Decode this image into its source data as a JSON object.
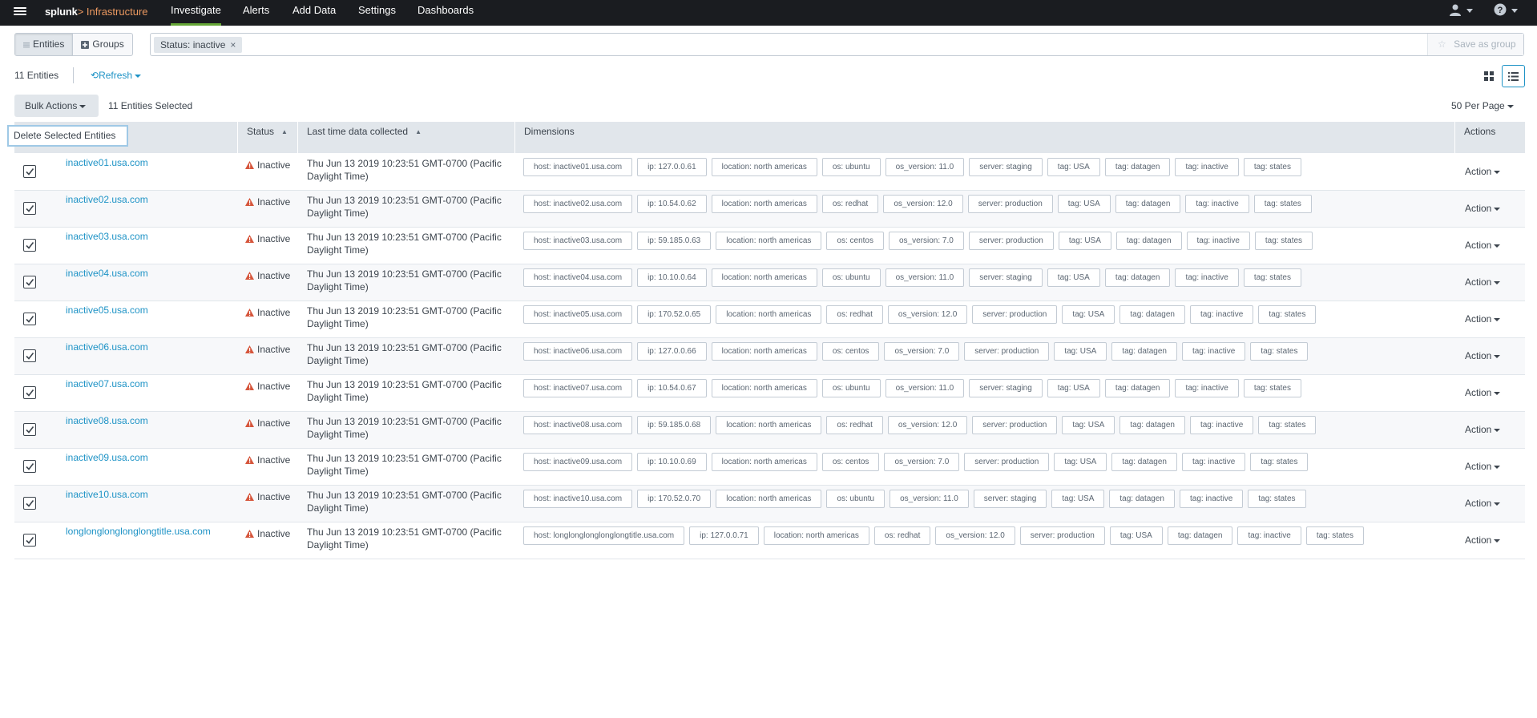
{
  "topnav": {
    "brand_splunk": "splunk",
    "brand_gt": ">",
    "brand_app": "Infrastructure",
    "items": [
      "Investigate",
      "Alerts",
      "Add Data",
      "Settings",
      "Dashboards"
    ],
    "active": "Investigate"
  },
  "toolbar": {
    "entities_tab": "Entities",
    "groups_tab": "Groups",
    "filter_chip": "Status: inactive",
    "chip_remove": "×",
    "save_as_group": "Save as group"
  },
  "summary": {
    "entity_count": "11 Entities",
    "refresh": "Refresh"
  },
  "bulk": {
    "bulk_actions": "Bulk Actions",
    "selected_text": "11 Entities Selected",
    "per_page": "50 Per Page",
    "tooltip": "Delete Selected Entities"
  },
  "table": {
    "headers": {
      "status": "Status",
      "last_time": "Last time data collected",
      "dimensions": "Dimensions",
      "actions": "Actions"
    },
    "rows": [
      {
        "name": "inactive01.usa.com",
        "status": "Inactive",
        "last_time": "Thu Jun 13 2019 10:23:51 GMT-0700 (Pacific Daylight Time)",
        "action": "Action",
        "dims": [
          "host: inactive01.usa.com",
          "ip: 127.0.0.61",
          "location: north americas",
          "os: ubuntu",
          "os_version: 11.0",
          "server: staging",
          "tag: USA",
          "tag: datagen",
          "tag: inactive",
          "tag: states"
        ]
      },
      {
        "name": "inactive02.usa.com",
        "status": "Inactive",
        "last_time": "Thu Jun 13 2019 10:23:51 GMT-0700 (Pacific Daylight Time)",
        "action": "Action",
        "dims": [
          "host: inactive02.usa.com",
          "ip: 10.54.0.62",
          "location: north americas",
          "os: redhat",
          "os_version: 12.0",
          "server: production",
          "tag: USA",
          "tag: datagen",
          "tag: inactive",
          "tag: states"
        ]
      },
      {
        "name": "inactive03.usa.com",
        "status": "Inactive",
        "last_time": "Thu Jun 13 2019 10:23:51 GMT-0700 (Pacific Daylight Time)",
        "action": "Action",
        "dims": [
          "host: inactive03.usa.com",
          "ip: 59.185.0.63",
          "location: north americas",
          "os: centos",
          "os_version: 7.0",
          "server: production",
          "tag: USA",
          "tag: datagen",
          "tag: inactive",
          "tag: states"
        ]
      },
      {
        "name": "inactive04.usa.com",
        "status": "Inactive",
        "last_time": "Thu Jun 13 2019 10:23:51 GMT-0700 (Pacific Daylight Time)",
        "action": "Action",
        "dims": [
          "host: inactive04.usa.com",
          "ip: 10.10.0.64",
          "location: north americas",
          "os: ubuntu",
          "os_version: 11.0",
          "server: staging",
          "tag: USA",
          "tag: datagen",
          "tag: inactive",
          "tag: states"
        ]
      },
      {
        "name": "inactive05.usa.com",
        "status": "Inactive",
        "last_time": "Thu Jun 13 2019 10:23:51 GMT-0700 (Pacific Daylight Time)",
        "action": "Action",
        "dims": [
          "host: inactive05.usa.com",
          "ip: 170.52.0.65",
          "location: north americas",
          "os: redhat",
          "os_version: 12.0",
          "server: production",
          "tag: USA",
          "tag: datagen",
          "tag: inactive",
          "tag: states"
        ]
      },
      {
        "name": "inactive06.usa.com",
        "status": "Inactive",
        "last_time": "Thu Jun 13 2019 10:23:51 GMT-0700 (Pacific Daylight Time)",
        "action": "Action",
        "dims": [
          "host: inactive06.usa.com",
          "ip: 127.0.0.66",
          "location: north americas",
          "os: centos",
          "os_version: 7.0",
          "server: production",
          "tag: USA",
          "tag: datagen",
          "tag: inactive",
          "tag: states"
        ]
      },
      {
        "name": "inactive07.usa.com",
        "status": "Inactive",
        "last_time": "Thu Jun 13 2019 10:23:51 GMT-0700 (Pacific Daylight Time)",
        "action": "Action",
        "dims": [
          "host: inactive07.usa.com",
          "ip: 10.54.0.67",
          "location: north americas",
          "os: ubuntu",
          "os_version: 11.0",
          "server: staging",
          "tag: USA",
          "tag: datagen",
          "tag: inactive",
          "tag: states"
        ]
      },
      {
        "name": "inactive08.usa.com",
        "status": "Inactive",
        "last_time": "Thu Jun 13 2019 10:23:51 GMT-0700 (Pacific Daylight Time)",
        "action": "Action",
        "dims": [
          "host: inactive08.usa.com",
          "ip: 59.185.0.68",
          "location: north americas",
          "os: redhat",
          "os_version: 12.0",
          "server: production",
          "tag: USA",
          "tag: datagen",
          "tag: inactive",
          "tag: states"
        ]
      },
      {
        "name": "inactive09.usa.com",
        "status": "Inactive",
        "last_time": "Thu Jun 13 2019 10:23:51 GMT-0700 (Pacific Daylight Time)",
        "action": "Action",
        "dims": [
          "host: inactive09.usa.com",
          "ip: 10.10.0.69",
          "location: north americas",
          "os: centos",
          "os_version: 7.0",
          "server: production",
          "tag: USA",
          "tag: datagen",
          "tag: inactive",
          "tag: states"
        ]
      },
      {
        "name": "inactive10.usa.com",
        "status": "Inactive",
        "last_time": "Thu Jun 13 2019 10:23:51 GMT-0700 (Pacific Daylight Time)",
        "action": "Action",
        "dims": [
          "host: inactive10.usa.com",
          "ip: 170.52.0.70",
          "location: north americas",
          "os: ubuntu",
          "os_version: 11.0",
          "server: staging",
          "tag: USA",
          "tag: datagen",
          "tag: inactive",
          "tag: states"
        ]
      },
      {
        "name": "longlonglonglonglongtitle.usa.com",
        "status": "Inactive",
        "last_time": "Thu Jun 13 2019 10:23:51 GMT-0700 (Pacific Daylight Time)",
        "action": "Action",
        "dims": [
          "host: longlonglonglonglongtitle.usa.com",
          "ip: 127.0.0.71",
          "location: north americas",
          "os: redhat",
          "os_version: 12.0",
          "server: production",
          "tag: USA",
          "tag: datagen",
          "tag: inactive",
          "tag: states"
        ]
      }
    ]
  },
  "icons": {
    "menu": "hamburger-icon",
    "entities": "list-icon",
    "groups": "plus-box-icon",
    "save": "star-icon",
    "refresh": "refresh-icon",
    "user": "user-icon",
    "help": "help-icon",
    "status": "warning-triangle-icon",
    "checkbox": "checkbox-checked-icon"
  },
  "colors": {
    "nav_bg": "#1a1c20",
    "brand_accent": "#ec9960",
    "active_tab_underline": "#65a637",
    "link": "#1e93c6",
    "warning": "#d6563c",
    "header_bg": "#e1e6eb"
  }
}
